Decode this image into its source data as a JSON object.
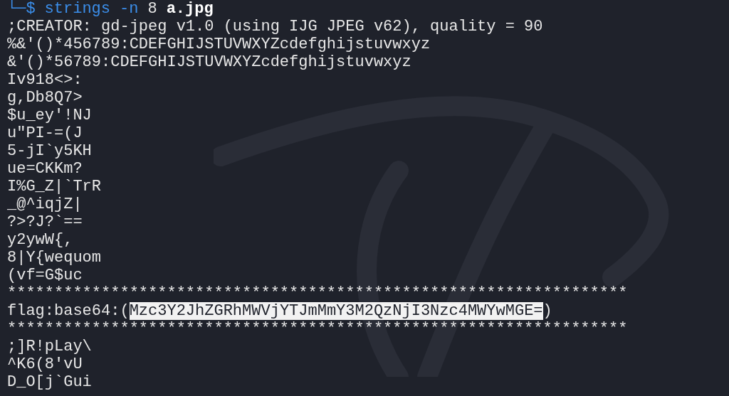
{
  "prompt": {
    "prefix": "└─$",
    "command": "strings",
    "option": "-n",
    "value": "8",
    "file": "a.jpg"
  },
  "lines": [
    {
      "kind": "text",
      "text": ";CREATOR: gd-jpeg v1.0 (using IJG JPEG v62), quality = 90"
    },
    {
      "kind": "text",
      "text": "%&'()*456789:CDEFGHIJSTUVWXYZcdefghijstuvwxyz"
    },
    {
      "kind": "text",
      "text": "&'()*56789:CDEFGHIJSTUVWXYZcdefghijstuvwxyz"
    },
    {
      "kind": "text",
      "text": "Iv918<>:"
    },
    {
      "kind": "text",
      "text": "g,Db8Q7>"
    },
    {
      "kind": "text",
      "text": "$u_ey'!NJ"
    },
    {
      "kind": "text",
      "text": "u\"PI-=(J"
    },
    {
      "kind": "text",
      "text": "5-jI`y5KH"
    },
    {
      "kind": "text",
      "text": "ue=CKKm?"
    },
    {
      "kind": "text",
      "text": "I%G_Z|`TrR"
    },
    {
      "kind": "text",
      "text": "_@^iqjZ|"
    },
    {
      "kind": "text",
      "text": "?>?J?`=="
    },
    {
      "kind": "text",
      "text": "y2ywW{,"
    },
    {
      "kind": "text",
      "text": "8|Y{wequom"
    },
    {
      "kind": "text",
      "text": "(vf=G$uc"
    },
    {
      "kind": "text",
      "text": "******************************************************************"
    },
    {
      "kind": "flag",
      "before": "flag:base64:(",
      "selection": "Mzc3Y2JhZGRhMWVjYTJmMmY3M2QzNjI3Nzc4MWYwMGE=",
      "after": ")"
    },
    {
      "kind": "text",
      "text": "******************************************************************"
    },
    {
      "kind": "text",
      "text": ";]R!pLay\\"
    },
    {
      "kind": "text",
      "text": "^K6(8'vU"
    },
    {
      "kind": "text",
      "text": "D_O[j`Gui"
    }
  ]
}
